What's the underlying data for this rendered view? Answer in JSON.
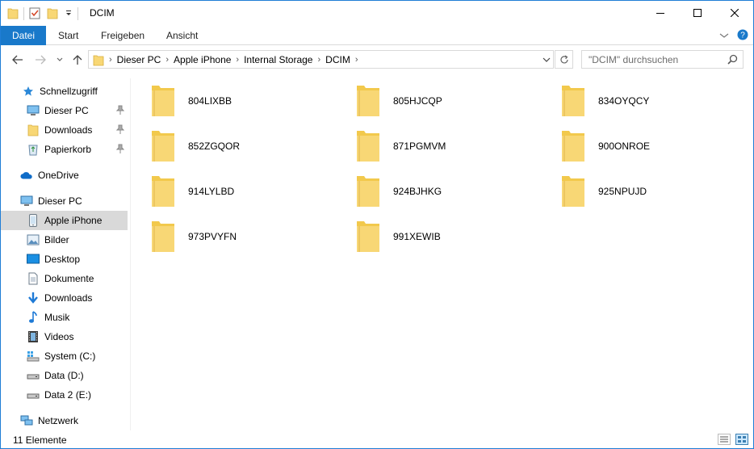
{
  "window": {
    "title": "DCIM"
  },
  "ribbon": {
    "tabs": [
      {
        "label": "Datei"
      },
      {
        "label": "Start"
      },
      {
        "label": "Freigeben"
      },
      {
        "label": "Ansicht"
      }
    ]
  },
  "address": {
    "crumbs": [
      "Dieser PC",
      "Apple iPhone",
      "Internal Storage",
      "DCIM"
    ]
  },
  "search": {
    "placeholder": "\"DCIM\" durchsuchen"
  },
  "nav": {
    "quick_access": "Schnellzugriff",
    "quick_items": [
      {
        "label": "Dieser PC",
        "icon": "computer-icon",
        "pinned": true
      },
      {
        "label": "Downloads",
        "icon": "folder-icon",
        "pinned": true
      },
      {
        "label": "Papierkorb",
        "icon": "recycle-bin-icon",
        "pinned": true
      }
    ],
    "onedrive": "OneDrive",
    "this_pc": "Dieser PC",
    "pc_items": [
      {
        "label": "Apple iPhone",
        "icon": "iphone-icon",
        "selected": true
      },
      {
        "label": "Bilder",
        "icon": "pictures-icon"
      },
      {
        "label": "Desktop",
        "icon": "desktop-icon"
      },
      {
        "label": "Dokumente",
        "icon": "documents-icon"
      },
      {
        "label": "Downloads",
        "icon": "downloads-icon"
      },
      {
        "label": "Musik",
        "icon": "music-icon"
      },
      {
        "label": "Videos",
        "icon": "videos-icon"
      },
      {
        "label": "System (C:)",
        "icon": "system-drive-icon"
      },
      {
        "label": "Data (D:)",
        "icon": "drive-icon"
      },
      {
        "label": "Data 2 (E:)",
        "icon": "drive-icon"
      }
    ],
    "network": "Netzwerk"
  },
  "folders": [
    "804LIXBB",
    "805HJCQP",
    "834OYQCY",
    "852ZGQOR",
    "871PGMVM",
    "900ONROE",
    "914LYLBD",
    "924BJHKG",
    "925NPUJD",
    "973PVYFN",
    "991XEWIB"
  ],
  "status": {
    "count": "11 Elemente"
  },
  "colors": {
    "accent": "#1979ca",
    "folder": "#f8d775",
    "selected": "#d9d9d9"
  }
}
